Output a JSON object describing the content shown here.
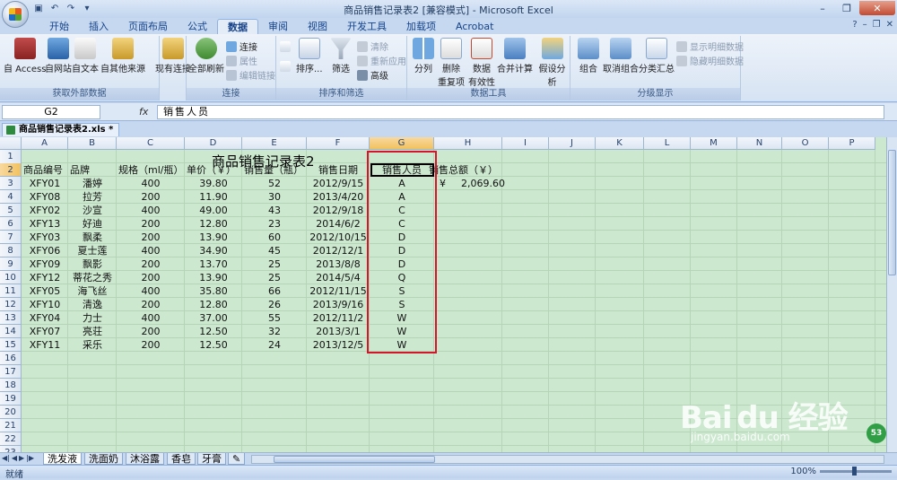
{
  "window": {
    "title": "商品销售记录表2 [兼容模式] - Microsoft Excel",
    "minimize": "–",
    "restore": "❐",
    "close": "✕"
  },
  "tabs": [
    {
      "label": "开始"
    },
    {
      "label": "插入"
    },
    {
      "label": "页面布局"
    },
    {
      "label": "公式"
    },
    {
      "label": "数据",
      "active": true
    },
    {
      "label": "审阅"
    },
    {
      "label": "视图"
    },
    {
      "label": "开发工具"
    },
    {
      "label": "加载项"
    },
    {
      "label": "Acrobat"
    }
  ],
  "ribbon": {
    "external": {
      "label": "获取外部数据",
      "access": "自 Access",
      "web": "自网站",
      "text": "自文本",
      "other": "自其他来源",
      "existing": "现有连接"
    },
    "connections": {
      "label": "连接",
      "refresh": "全部刷新",
      "connections": "连接",
      "properties": "属性",
      "edit_links": "编辑链接"
    },
    "sort": {
      "label": "排序和筛选",
      "sort": "排序...",
      "filter": "筛选",
      "clear": "清除",
      "reapply": "重新应用",
      "advanced": "高级"
    },
    "tools": {
      "label": "数据工具",
      "split": "分列",
      "dedupe1": "删除",
      "dedupe2": "重复项",
      "validate1": "数据",
      "validate2": "有效性",
      "consolidate": "合并计算",
      "whatif": "假设分析"
    },
    "outline": {
      "label": "分级显示",
      "group": "组合",
      "ungroup": "取消组合",
      "subtotal": "分类汇总",
      "show_detail": "显示明细数据",
      "hide_detail": "隐藏明细数据"
    }
  },
  "formula_bar": {
    "name_box": "G2",
    "fx": "fx",
    "content": "销售人员"
  },
  "doc_tab": "商品销售记录表2.xls *",
  "columns": [
    "A",
    "B",
    "C",
    "D",
    "E",
    "F",
    "G",
    "H",
    "I",
    "J",
    "K",
    "L",
    "M",
    "N",
    "O",
    "P"
  ],
  "rows": [
    "1",
    "2",
    "3",
    "4",
    "5",
    "6",
    "7",
    "8",
    "9",
    "10",
    "11",
    "12",
    "13",
    "14",
    "15",
    "16",
    "17",
    "18",
    "19",
    "20",
    "21",
    "22",
    "23"
  ],
  "sheet": {
    "title": "商品销售记录表2",
    "headers": [
      "商品编号",
      "品牌",
      "规格（ml/瓶）",
      "单价（￥）",
      "销售量（瓶）",
      "销售日期",
      "销售人员",
      "销售总额（￥）"
    ],
    "rows": [
      [
        "XFY01",
        "潘婷",
        "400",
        "39.80",
        "52",
        "2012/9/15",
        "A"
      ],
      [
        "XFY08",
        "拉芳",
        "200",
        "11.90",
        "30",
        "2013/4/20",
        "A"
      ],
      [
        "XFY02",
        "沙宣",
        "400",
        "49.00",
        "43",
        "2012/9/18",
        "C"
      ],
      [
        "XFY13",
        "好迪",
        "200",
        "12.80",
        "23",
        "2014/6/2",
        "C"
      ],
      [
        "XFY03",
        "飘柔",
        "200",
        "13.90",
        "60",
        "2012/10/15",
        "D"
      ],
      [
        "XFY06",
        "夏士莲",
        "400",
        "34.90",
        "45",
        "2012/12/1",
        "D"
      ],
      [
        "XFY09",
        "飘影",
        "200",
        "13.70",
        "25",
        "2013/8/8",
        "D"
      ],
      [
        "XFY12",
        "蒂花之秀",
        "200",
        "13.90",
        "25",
        "2014/5/4",
        "Q"
      ],
      [
        "XFY05",
        "海飞丝",
        "400",
        "35.80",
        "66",
        "2012/11/15",
        "S"
      ],
      [
        "XFY10",
        "清逸",
        "200",
        "12.80",
        "26",
        "2013/9/16",
        "S"
      ],
      [
        "XFY04",
        "力士",
        "400",
        "37.00",
        "55",
        "2012/11/2",
        "W"
      ],
      [
        "XFY07",
        "亮荘",
        "200",
        "12.50",
        "32",
        "2013/3/1",
        "W"
      ],
      [
        "XFY11",
        "采乐",
        "200",
        "12.50",
        "24",
        "2013/12/5",
        "W"
      ]
    ],
    "total_symbol": "¥",
    "total_value": "2,069.60"
  },
  "sheet_tabs": [
    "洗发液",
    "洗面奶",
    "沐浴露",
    "香皂",
    "牙膏"
  ],
  "status": {
    "ready": "就绪",
    "zoom": "100%"
  },
  "watermark": {
    "text": "Bai du 经验",
    "sub": "jingyan.baidu.com",
    "badge": "53"
  }
}
